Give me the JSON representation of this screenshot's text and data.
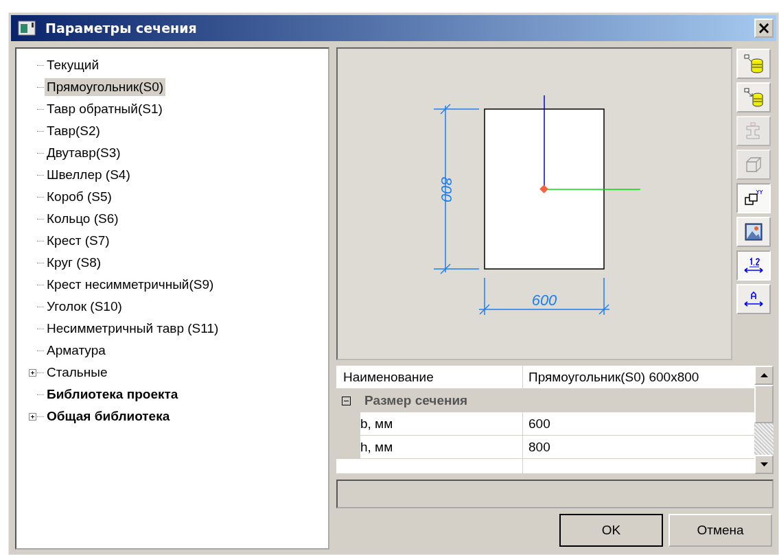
{
  "window": {
    "title": "Параметры сечения",
    "close_label": "×"
  },
  "tree": [
    {
      "label": "Текущий",
      "kind": "plain",
      "selected": false,
      "expandable": false
    },
    {
      "label": "Прямоугольник(S0)",
      "kind": "plain",
      "selected": true,
      "expandable": false
    },
    {
      "label": "Тавр обратный(S1)",
      "kind": "plain",
      "selected": false,
      "expandable": false
    },
    {
      "label": "Тавр(S2)",
      "kind": "plain",
      "selected": false,
      "expandable": false
    },
    {
      "label": "Двутавр(S3)",
      "kind": "plain",
      "selected": false,
      "expandable": false
    },
    {
      "label": "Швеллер (S4)",
      "kind": "plain",
      "selected": false,
      "expandable": false
    },
    {
      "label": "Короб (S5)",
      "kind": "plain",
      "selected": false,
      "expandable": false
    },
    {
      "label": "Кольцо (S6)",
      "kind": "plain",
      "selected": false,
      "expandable": false
    },
    {
      "label": "Крест (S7)",
      "kind": "plain",
      "selected": false,
      "expandable": false
    },
    {
      "label": "Круг (S8)",
      "kind": "plain",
      "selected": false,
      "expandable": false
    },
    {
      "label": "Крест несимметричный(S9)",
      "kind": "plain",
      "selected": false,
      "expandable": false
    },
    {
      "label": "Уголок (S10)",
      "kind": "plain",
      "selected": false,
      "expandable": false
    },
    {
      "label": "Несимметричный тавр (S11)",
      "kind": "plain",
      "selected": false,
      "expandable": false
    },
    {
      "label": "Арматура",
      "kind": "plain",
      "selected": false,
      "expandable": false
    },
    {
      "label": "Стальные",
      "kind": "plain",
      "selected": false,
      "expandable": true
    },
    {
      "label": "Библиотека проекта",
      "kind": "library",
      "selected": false,
      "expandable": false
    },
    {
      "label": "Общая библиотека",
      "kind": "library",
      "selected": false,
      "expandable": true
    }
  ],
  "preview": {
    "height_label": "800",
    "width_label": "600"
  },
  "tools": [
    {
      "disabled": false,
      "pressed": false
    },
    {
      "disabled": false,
      "pressed": false
    },
    {
      "disabled": true,
      "pressed": false
    },
    {
      "disabled": true,
      "pressed": false
    },
    {
      "disabled": false,
      "pressed": true
    },
    {
      "disabled": false,
      "pressed": false
    },
    {
      "disabled": false,
      "pressed": true
    },
    {
      "disabled": false,
      "pressed": false
    }
  ],
  "properties": {
    "name_row": {
      "label": "Наименование",
      "value": "Прямоугольник(S0) 600x800"
    },
    "category": {
      "label": "Размер сечения",
      "expanded": true
    },
    "rows": [
      {
        "label": "b, мм",
        "value": "600"
      },
      {
        "label": "h, мм",
        "value": "800"
      }
    ]
  },
  "buttons": [
    {
      "label": "OK",
      "default": true
    },
    {
      "label": "Отмена",
      "default": false
    }
  ]
}
